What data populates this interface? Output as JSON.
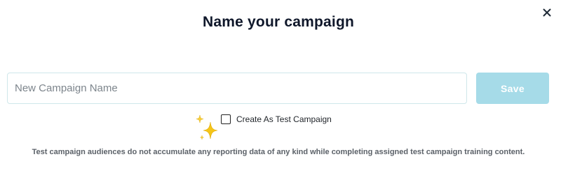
{
  "dialog": {
    "title": "Name your campaign",
    "close_icon": "close-icon"
  },
  "form": {
    "name_input": {
      "value": "",
      "placeholder": "New Campaign Name"
    },
    "save_label": "Save",
    "test_campaign": {
      "label": "Create As Test Campaign",
      "checked": false,
      "icon": "sparkles-icon"
    },
    "helper_text": "Test campaign audiences do not accumulate any reporting data of any kind while completing assigned test campaign training content."
  },
  "colors": {
    "save_button_bg": "#a6dbe8",
    "input_border": "#cfe7ea",
    "sparkle": "#f5c518"
  }
}
